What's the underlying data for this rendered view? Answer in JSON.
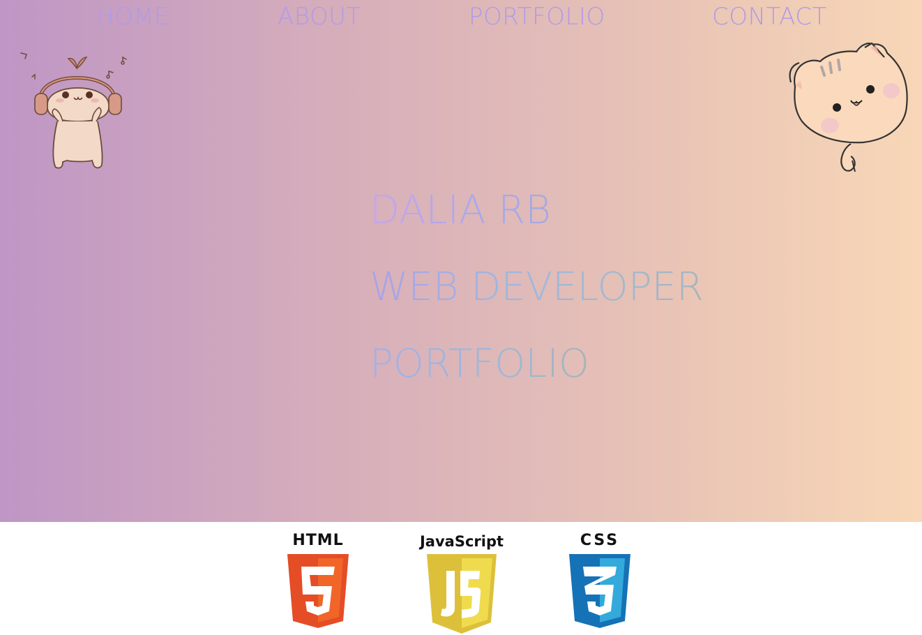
{
  "nav": {
    "items": [
      {
        "label": "HOME"
      },
      {
        "label": "ABOUT"
      },
      {
        "label": "PORTFOLIO"
      },
      {
        "label": "CONTACT"
      }
    ]
  },
  "hero": {
    "name": "DALIA RB",
    "role": "WEB DEVELOPER",
    "subtitle": "PORTFOLIO"
  },
  "mascots": {
    "left": "headphones-mascot-icon",
    "right": "cat-mascot-icon"
  },
  "logos": {
    "html": {
      "label": "HTML",
      "digit": "5",
      "color": "#e44d26"
    },
    "js": {
      "label": "JavaScript",
      "letters": "JS",
      "color": "#f0db4f"
    },
    "css": {
      "label": "CSS",
      "digit": "3",
      "color": "#1572b6"
    }
  },
  "colors": {
    "gradient_start": "#bf96c5",
    "gradient_end": "#f8d7b7",
    "nav_text": "#b09be6"
  }
}
